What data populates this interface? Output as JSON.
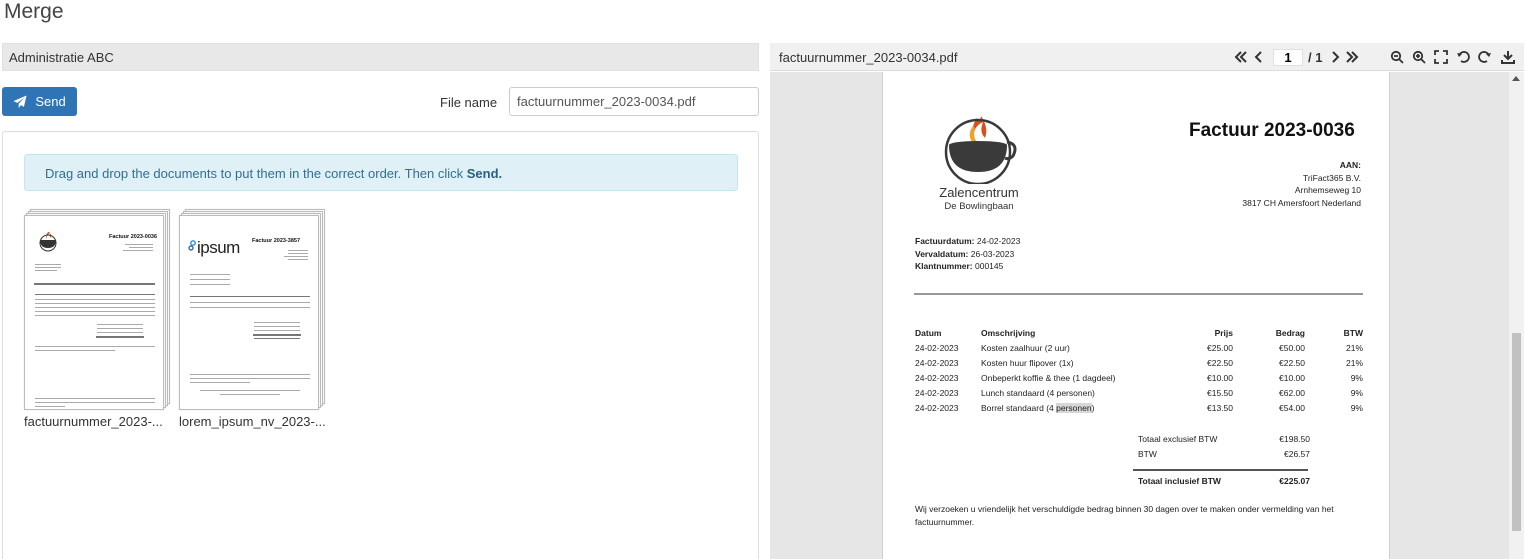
{
  "page": {
    "title": "Merge"
  },
  "left": {
    "header": "Administratie ABC",
    "send_label": "Send",
    "file_name_label": "File name",
    "file_name_value": "factuurnummer_2023-0034.pdf",
    "info_text": "Drag and drop the documents to put them in the correct order. Then click ",
    "info_bold": "Send.",
    "documents": [
      {
        "label": "factuurnummer_2023-...",
        "thumb_title": "Factuur 2023-0036"
      },
      {
        "label": "lorem_ipsum_nv_2023-...",
        "thumb_title": "Factuur 2023-3857",
        "logo_text": "ipsum"
      }
    ]
  },
  "viewer": {
    "filename": "factuurnummer_2023-0034.pdf",
    "page_current": "1",
    "page_total": "/ 1",
    "icons": [
      "first-page-icon",
      "prev-page-icon",
      "next-page-icon",
      "last-page-icon",
      "zoom-out-icon",
      "zoom-in-icon",
      "fullscreen-icon",
      "rotate-left-icon",
      "rotate-right-icon",
      "download-icon"
    ],
    "scroll_position": 0.55
  },
  "invoice": {
    "title": "Factuur 2023-0036",
    "to_label": "AAN:",
    "to_lines": [
      "TriFact365 B.V.",
      "Arnhemseweg 10",
      "3817 CH  Amersfoort Nederland"
    ],
    "brand_line1": "Zalencentrum",
    "brand_line2": "De Bowlingbaan",
    "meta": [
      {
        "label": "Factuurdatum:",
        "value": " 24-02-2023"
      },
      {
        "label": "Vervaldatum:",
        "value": " 26-03-2023"
      },
      {
        "label": "Klantnummer:",
        "value": " 000145"
      }
    ],
    "columns": [
      "Datum",
      "Omschrijving",
      "Prijs",
      "Bedrag",
      "BTW"
    ],
    "rows": [
      {
        "date": "24-02-2023",
        "desc": "Kosten zaalhuur (2 uur)",
        "price": "€25.00",
        "amount": "€50.00",
        "btw": "21%"
      },
      {
        "date": "24-02-2023",
        "desc": "Kosten huur flipover (1x)",
        "price": "€22.50",
        "amount": "€22.50",
        "btw": "21%"
      },
      {
        "date": "24-02-2023",
        "desc": "Onbeperkt koffie & thee (1 dagdeel)",
        "price": "€10.00",
        "amount": "€10.00",
        "btw": "9%"
      },
      {
        "date": "24-02-2023",
        "desc": "Lunch standaard (4 personen)",
        "price": "€15.50",
        "amount": "€62.00",
        "btw": "9%"
      },
      {
        "date": "24-02-2023",
        "desc_pre": "Borrel standaard (4 ",
        "desc_hl": "personen",
        "desc_post": ")",
        "price": "€13.50",
        "amount": "€54.00",
        "btw": "9%"
      }
    ],
    "totals": [
      {
        "label": "Totaal exclusief BTW",
        "value": "€198.50"
      },
      {
        "label": "BTW",
        "value": "€26.57"
      }
    ],
    "grand_total": {
      "label": "Totaal inclusief BTW",
      "value": "€225.07"
    },
    "note": "Wij verzoeken u vriendelijk het verschuldigde bedrag binnen 30 dagen over te maken onder vermelding van het factuurnummer."
  }
}
